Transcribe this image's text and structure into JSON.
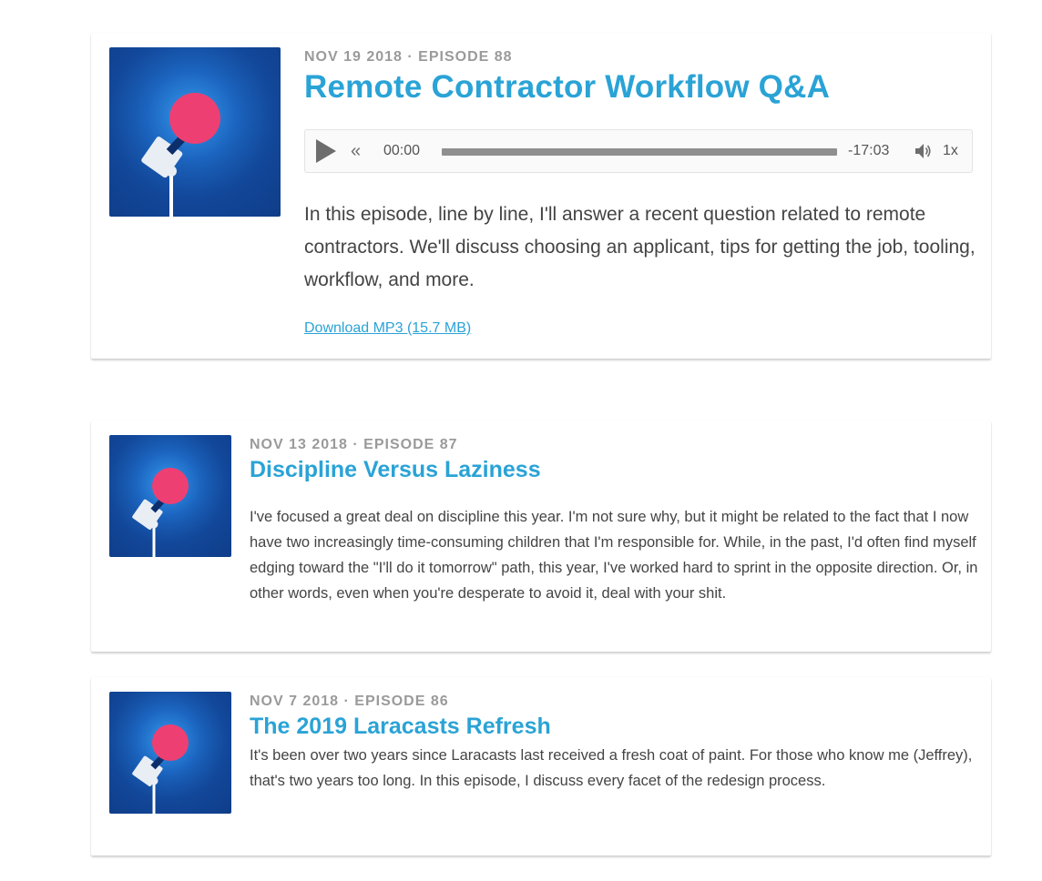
{
  "episodes": [
    {
      "meta": "NOV 19 2018 · EPISODE 88",
      "title": "Remote Contractor Workflow Q&A",
      "description": "In this episode, line by line, I'll answer a recent question related to remote contractors. We'll discuss choosing an applicant, tips for getting the job, tooling, workflow, and more.",
      "player": {
        "current_time": "00:00",
        "remaining_time": "-17:03",
        "speed": "1x",
        "progress": 0
      },
      "download_label": "Download MP3 (15.7 MB)"
    },
    {
      "meta": "NOV 13 2018 · EPISODE 87",
      "title": "Discipline Versus Laziness",
      "description": "I've focused a great deal on discipline this year. I'm not sure why, but it might be related to the fact that I now have two increasingly time-consuming children that I'm responsible for. While, in the past, I'd often find myself edging toward the \"I'll do it tomorrow\" path, this year, I've worked hard to sprint in the opposite direction. Or, in other words, even when you're desperate to avoid it, deal with your shit."
    },
    {
      "meta": "NOV 7 2018 · EPISODE 86",
      "title": "The 2019 Laracasts Refresh",
      "description": "It's been over two years since Laracasts last received a fresh coat of paint. For those who know me (Jeffrey), that's two years too long. In this episode, I discuss every facet of the redesign process."
    }
  ],
  "icons": {
    "play": "play-icon",
    "rewind": "rewind-icon",
    "volume": "volume-icon",
    "artwork": "microphone-icon"
  },
  "colors": {
    "title": "#2aa3d6",
    "meta": "#9a9a9a",
    "artwork_bg": "#1757ad",
    "mic_head": "#ee3f72"
  }
}
